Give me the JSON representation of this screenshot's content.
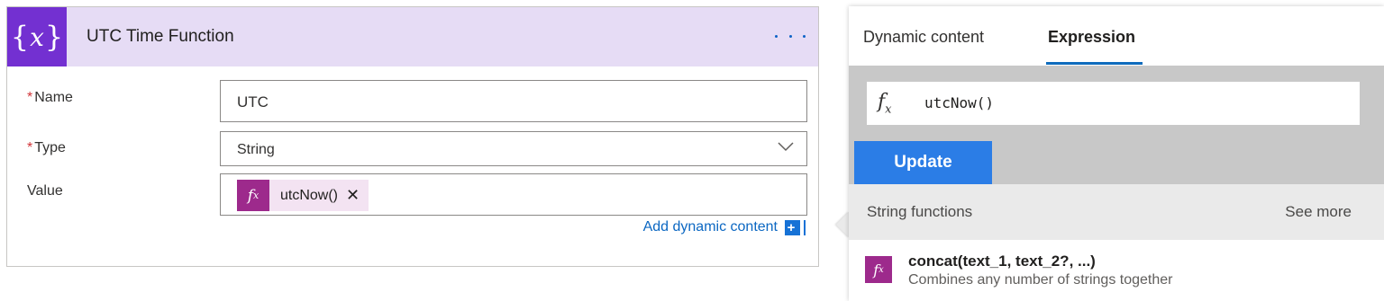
{
  "action_card": {
    "title": "UTC Time Function",
    "icon": "variable-icon",
    "icon_glyph_open": "{",
    "icon_glyph_var": "x",
    "icon_glyph_close": "}",
    "more_icon": "ellipsis-icon",
    "required_marker": "*",
    "fields": {
      "name": {
        "label": "Name",
        "value": "UTC"
      },
      "type": {
        "label": "Type",
        "value": "String"
      },
      "value": {
        "label": "Value",
        "token_label": "utcNow()",
        "token_remove": "✕",
        "token_icon": "fx-icon"
      }
    },
    "add_dynamic_content": "Add dynamic content",
    "add_dynamic_icon": "+"
  },
  "expression_panel": {
    "tabs": [
      {
        "label": "Dynamic content",
        "active": false
      },
      {
        "label": "Expression",
        "active": true
      }
    ],
    "expression_value": "utcNow()",
    "fx_glyph": "f",
    "fx_sub": "x",
    "update_label": "Update",
    "section": {
      "title": "String functions",
      "see_more": "See more"
    },
    "functions": [
      {
        "name": "concat(text_1, text_2?, ...)",
        "description": "Combines any number of strings together"
      }
    ]
  },
  "colors": {
    "header_bg": "#e6dcf5",
    "action_icon_bg": "#7330d1",
    "expression_token": "#9d2a8c",
    "link_blue": "#0b67c2",
    "update_button": "#2b7de6",
    "required": "#d13438"
  }
}
